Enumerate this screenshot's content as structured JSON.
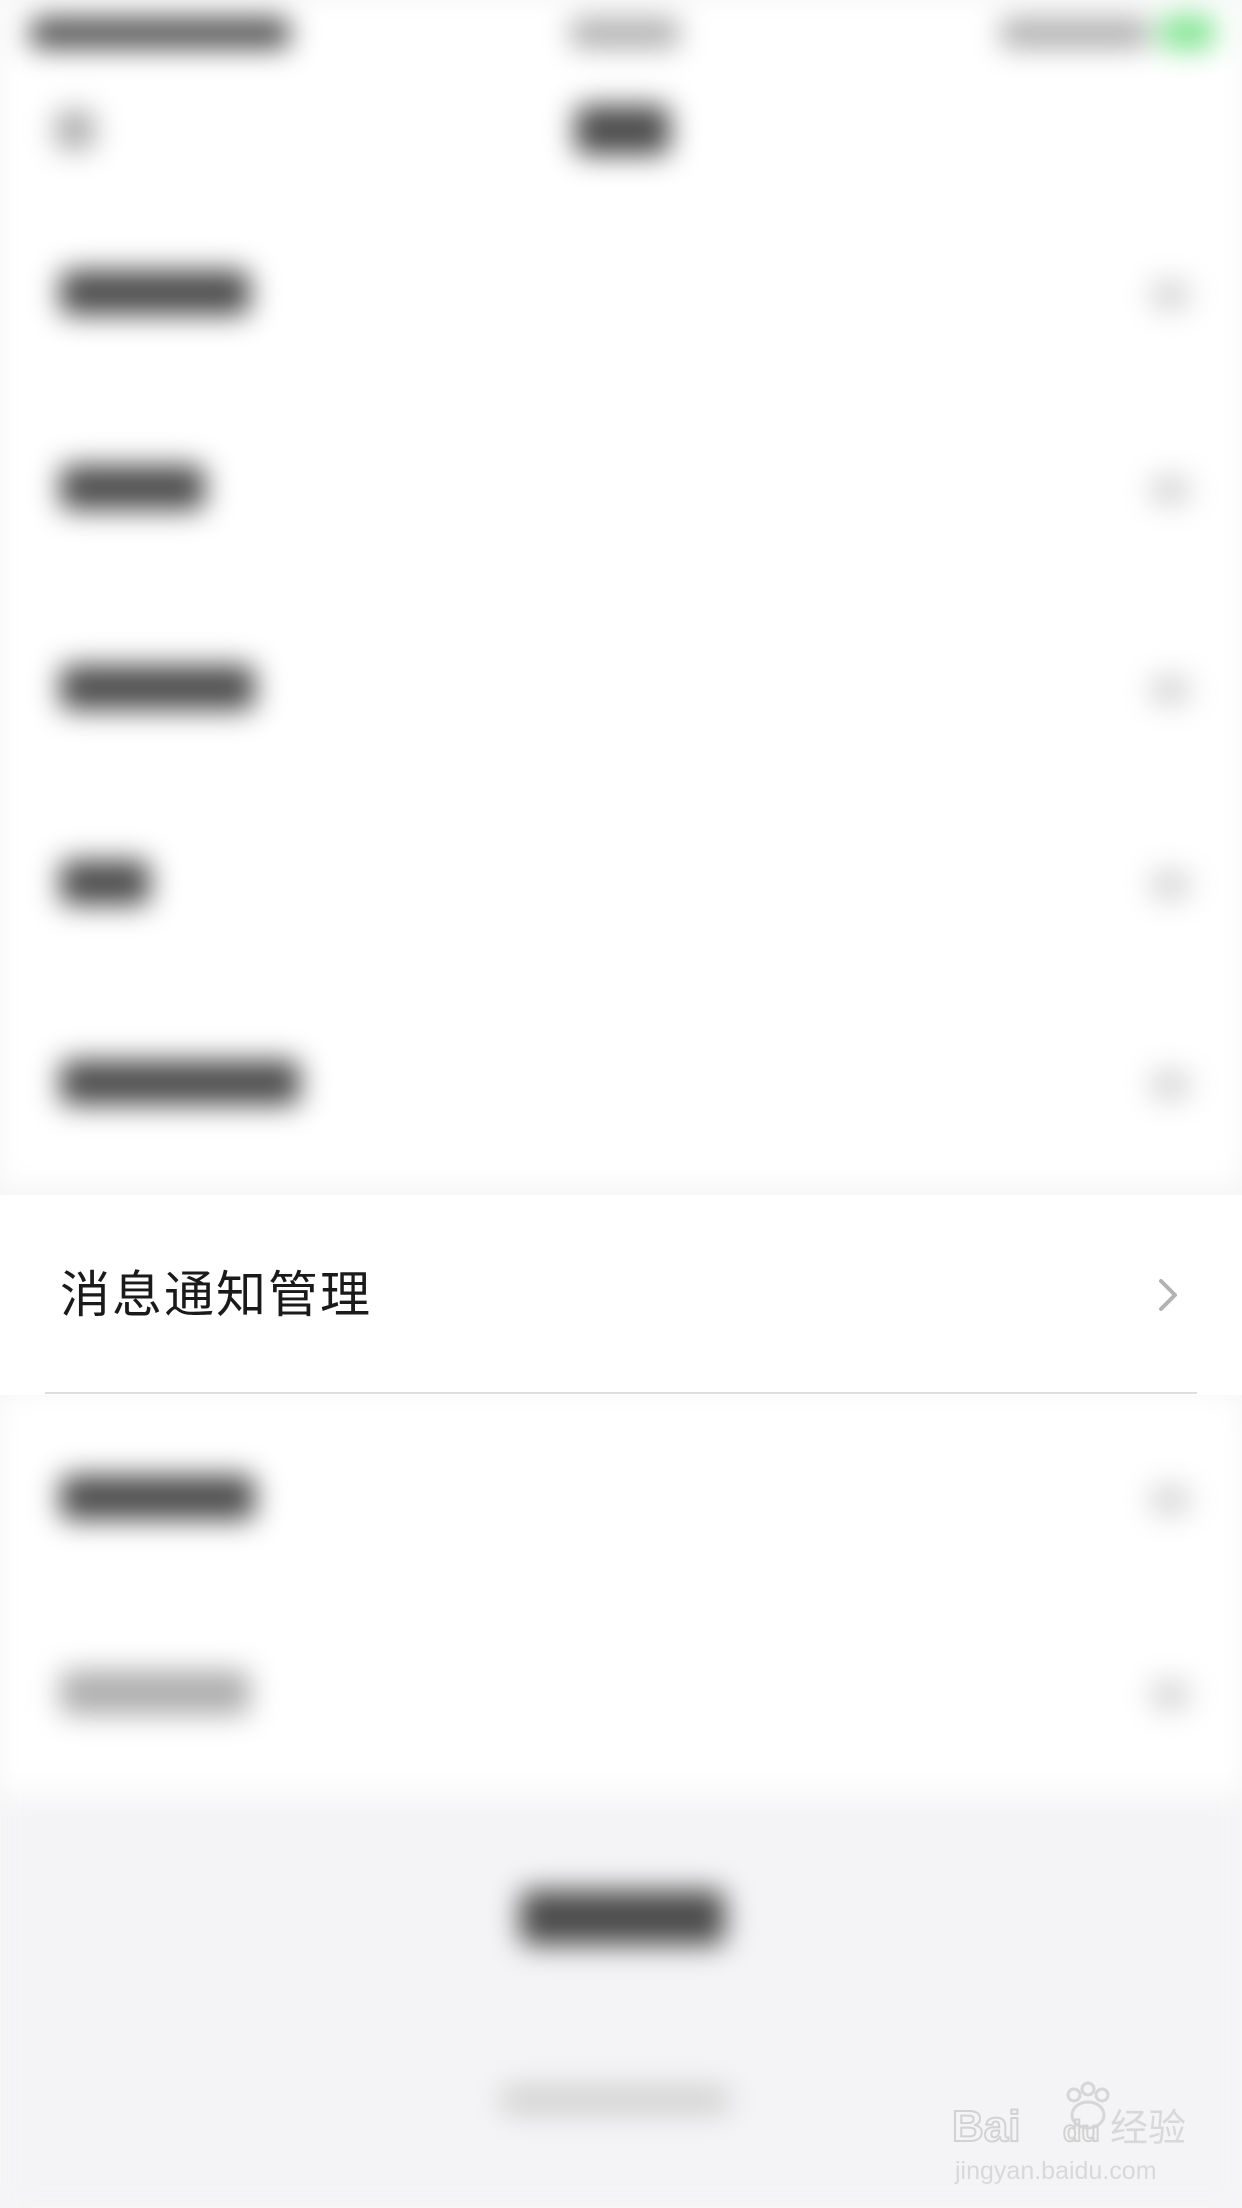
{
  "settings": {
    "focused_row": {
      "label": "消息通知管理",
      "chevron_icon": "chevron-right-icon"
    }
  },
  "watermark": {
    "brand": "Baidu经验",
    "url": "jingyan.baidu.com"
  },
  "colors": {
    "text_primary": "#1a1a1a",
    "chevron": "#b2b2b2",
    "divider": "#dedede",
    "status_green": "#4cd964"
  }
}
